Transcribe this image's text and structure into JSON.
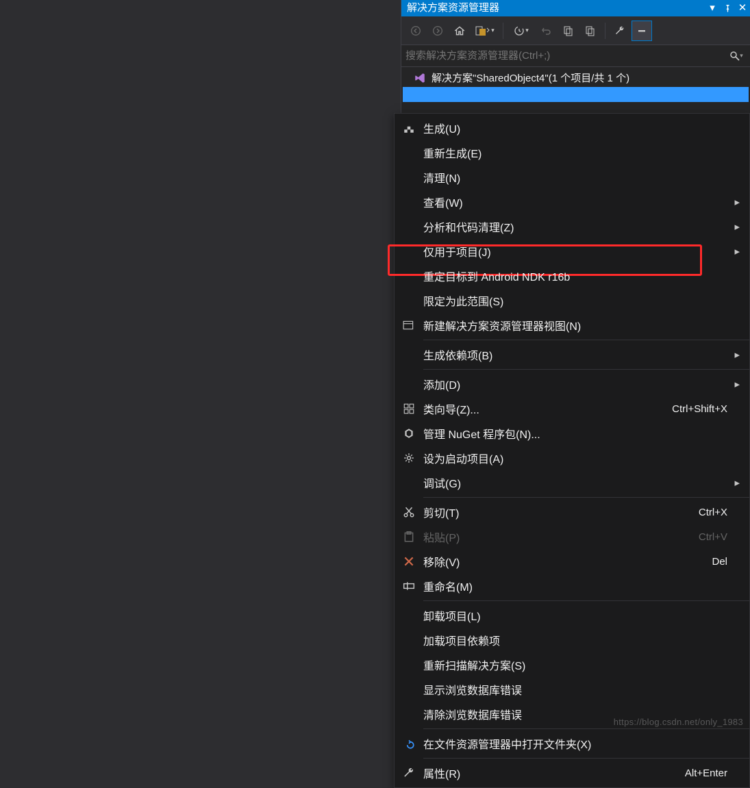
{
  "panel": {
    "title": "解决方案资源管理器",
    "search_placeholder": "搜索解决方案资源管理器(Ctrl+;)",
    "tree": {
      "solution_label": "解决方案\"SharedObject4\"(1 个项目/共 1 个)"
    }
  },
  "context_menu": {
    "items": [
      {
        "label": "生成(U)",
        "icon": "build-icon"
      },
      {
        "label": "重新生成(E)"
      },
      {
        "label": "清理(N)"
      },
      {
        "label": "查看(W)",
        "submenu": true
      },
      {
        "label": "分析和代码清理(Z)",
        "submenu": true
      },
      {
        "label": "仅用于项目(J)",
        "submenu": true
      },
      {
        "label": "重定目标到 Android NDK r16b",
        "highlighted": true
      },
      {
        "label": "限定为此范围(S)"
      },
      {
        "label": "新建解决方案资源管理器视图(N)",
        "icon": "new-view-icon"
      },
      {
        "sep": true
      },
      {
        "label": "生成依赖项(B)",
        "submenu": true
      },
      {
        "sep": true
      },
      {
        "label": "添加(D)",
        "submenu": true
      },
      {
        "label": "类向导(Z)...",
        "icon": "class-wizard-icon",
        "shortcut": "Ctrl+Shift+X"
      },
      {
        "label": "管理 NuGet 程序包(N)...",
        "icon": "nuget-icon"
      },
      {
        "label": "设为启动项目(A)",
        "icon": "gear-icon"
      },
      {
        "label": "调试(G)",
        "submenu": true
      },
      {
        "sep": true
      },
      {
        "label": "剪切(T)",
        "icon": "cut-icon",
        "shortcut": "Ctrl+X"
      },
      {
        "label": "粘贴(P)",
        "icon": "paste-icon",
        "shortcut": "Ctrl+V",
        "disabled": true
      },
      {
        "label": "移除(V)",
        "icon": "remove-icon",
        "shortcut": "Del"
      },
      {
        "label": "重命名(M)",
        "icon": "rename-icon"
      },
      {
        "sep": true
      },
      {
        "label": "卸载项目(L)"
      },
      {
        "label": "加载项目依赖项"
      },
      {
        "label": "重新扫描解决方案(S)"
      },
      {
        "label": "显示浏览数据库错误"
      },
      {
        "label": "清除浏览数据库错误"
      },
      {
        "sep": true
      },
      {
        "label": "在文件资源管理器中打开文件夹(X)",
        "icon": "open-folder-icon"
      },
      {
        "sep": true
      },
      {
        "label": "属性(R)",
        "icon": "properties-icon",
        "shortcut": "Alt+Enter"
      }
    ]
  },
  "watermark": "https://blog.csdn.net/only_1983"
}
